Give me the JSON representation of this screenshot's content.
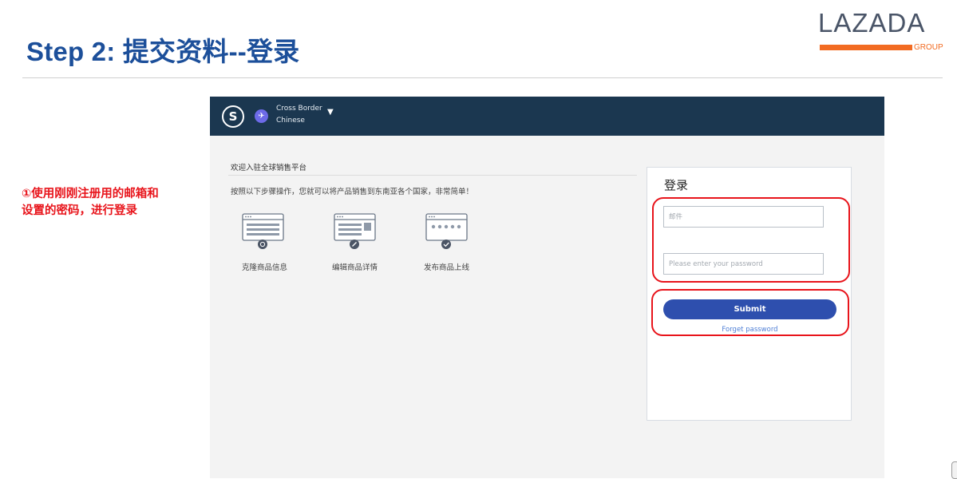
{
  "slide": {
    "title": "Step 2: 提交资料--登录",
    "logo": {
      "word": "LAZADA",
      "sub": "GROUP"
    },
    "annotation": "①使用刚刚注册用的邮箱和设置的密码，进行登录"
  },
  "app": {
    "account": {
      "line1": "Cross Border",
      "line2": "Chinese"
    },
    "welcome": "欢迎入驻全球销售平台",
    "intro": "按照以下步骤操作，您就可以将产品销售到东南亚各个国家，非常简单！",
    "steps": [
      {
        "label": "克隆商品信息",
        "icon": "clone-listing-icon"
      },
      {
        "label": "编辑商品详情",
        "icon": "edit-listing-icon"
      },
      {
        "label": "发布商品上线",
        "icon": "publish-listing-icon"
      }
    ],
    "login": {
      "title": "登录",
      "email_placeholder": "邮件",
      "password_placeholder": "Please enter your password",
      "submit_label": "Submit",
      "forgot_label": "Forget password"
    }
  },
  "colors": {
    "title_blue": "#1c4f9a",
    "annotation_red": "#e8141b",
    "header_navy": "#1b3750",
    "button_blue": "#2e4fae",
    "brand_orange": "#f26b22"
  }
}
